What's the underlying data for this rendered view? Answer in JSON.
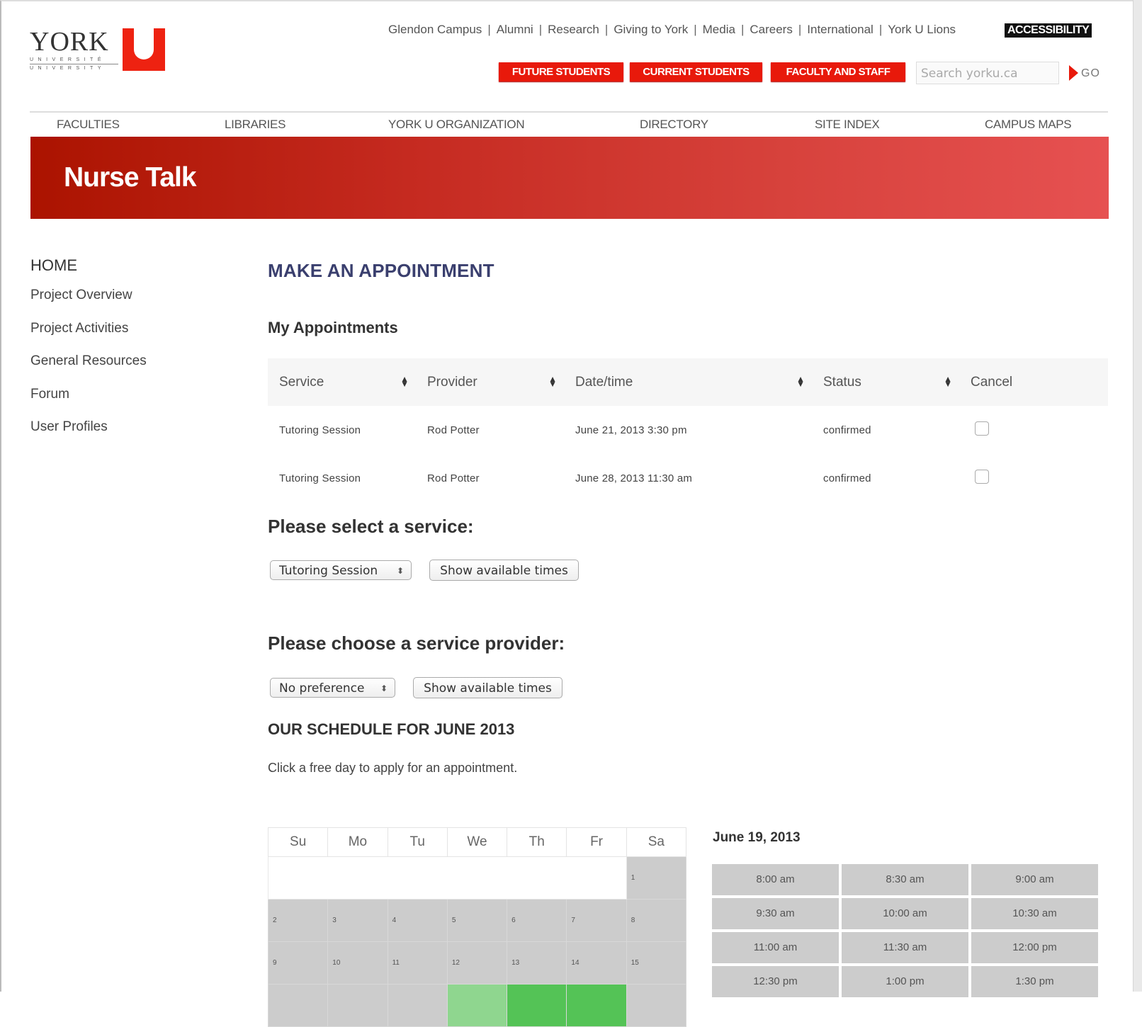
{
  "logo": {
    "wordmark": "YORK",
    "sub1": "UNIVERSITÉ",
    "sub2": "UNIVERSITY",
    "mark": "U"
  },
  "top_links": [
    "Glendon Campus",
    "Alumni",
    "Research",
    "Giving to York",
    "Media",
    "Careers",
    "International",
    "York U Lions"
  ],
  "top_separator": "|",
  "accessibility_label": "ACCESSIBILITY",
  "audience_buttons": [
    "FUTURE STUDENTS",
    "CURRENT STUDENTS",
    "FACULTY AND STAFF"
  ],
  "search": {
    "placeholder": "Search yorku.ca",
    "go_label": "GO"
  },
  "nav": [
    "FACULTIES",
    "LIBRARIES",
    "YORK U ORGANIZATION",
    "DIRECTORY",
    "SITE INDEX",
    "CAMPUS MAPS"
  ],
  "banner_title": "Nurse Talk",
  "colors": {
    "brand_red": "#e8190b",
    "banner_start": "#ab1300",
    "banner_end": "#e65151",
    "heading_navy": "#3a3f6e",
    "free_day_light": "#8fd68f",
    "free_day": "#54c356",
    "slot_gray": "#cccccc"
  },
  "sidebar": [
    "HOME",
    "Project Overview",
    "Project Activities",
    "General Resources",
    "Forum",
    "User Profiles"
  ],
  "main": {
    "title": "MAKE AN APPOINTMENT",
    "my_appointments": {
      "heading": "My Appointments",
      "columns": [
        "Service",
        "Provider",
        "Date/time",
        "Status",
        "Cancel"
      ],
      "sort_icon": "⬍",
      "rows": [
        {
          "service": "Tutoring Session",
          "provider": "Rod Potter",
          "datetime": "June 21, 2013 3:30 pm",
          "status": "confirmed",
          "cancel_checked": false
        },
        {
          "service": "Tutoring Session",
          "provider": "Rod Potter",
          "datetime": "June 28, 2013 11:30 am",
          "status": "confirmed",
          "cancel_checked": false
        }
      ]
    },
    "service": {
      "heading": "Please select a service:",
      "selected": "Tutoring Session",
      "button": "Show available times"
    },
    "provider": {
      "heading": "Please choose a service provider:",
      "selected": "No preference",
      "button": "Show available times"
    },
    "schedule": {
      "heading": "OUR SCHEDULE FOR JUNE 2013",
      "note": "Click a free day to apply for an appointment.",
      "weekdays": [
        "Su",
        "Mo",
        "Tu",
        "We",
        "Th",
        "Fr",
        "Sa"
      ],
      "weeks": [
        [
          "",
          "",
          "",
          "",
          "",
          "",
          "1"
        ],
        [
          "2",
          "3",
          "4",
          "5",
          "6",
          "7",
          "8"
        ],
        [
          "9",
          "10",
          "11",
          "12",
          "13",
          "14",
          "15"
        ],
        [
          "",
          "",
          "",
          "",
          "",
          "",
          ""
        ]
      ],
      "week4_status": [
        "busy",
        "busy",
        "busy",
        "light-green",
        "green",
        "green",
        "busy"
      ],
      "selected_date": "June 19, 2013",
      "time_slots": [
        "8:00 am",
        "8:30 am",
        "9:00 am",
        "9:30 am",
        "10:00 am",
        "10:30 am",
        "11:00 am",
        "11:30 am",
        "12:00 pm",
        "12:30 pm",
        "1:00 pm",
        "1:30 pm"
      ]
    }
  }
}
